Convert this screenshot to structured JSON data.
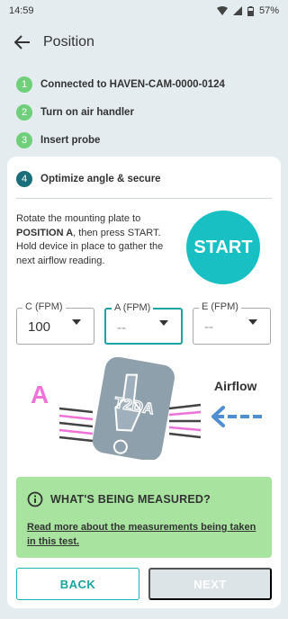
{
  "status_bar": {
    "time": "14:59",
    "battery_percent": "57%"
  },
  "app_bar": {
    "title": "Position"
  },
  "steps": [
    {
      "number": "1",
      "label": "Connected to HAVEN-CAM-0000-0124"
    },
    {
      "number": "2",
      "label": "Turn on air handler"
    },
    {
      "number": "3",
      "label": "Insert probe"
    }
  ],
  "current_step": {
    "number": "4",
    "label": "Optimize angle & secure"
  },
  "instructions": {
    "part1": "Rotate the mounting plate to ",
    "position": "POSITION A",
    "part2": ", then press START. Hold device in place to gather the next airflow reading."
  },
  "start_button": {
    "label": "START"
  },
  "fields": [
    {
      "label": "C (FPM)",
      "value": "100"
    },
    {
      "label": "A (FPM)",
      "value": "--"
    },
    {
      "label": "E (FPM)",
      "value": "--"
    }
  ],
  "illustration": {
    "position_letter": "A",
    "plate_text": "T2DA",
    "airflow_label": "Airflow"
  },
  "info_box": {
    "title": "WHAT'S BEING MEASURED?",
    "link_text": "Read more about the measurements being taken in this test."
  },
  "buttons": {
    "back": "BACK",
    "next": "NEXT"
  },
  "colors": {
    "accent": "#19c0c3",
    "step_done": "#6fcf7a",
    "info_bg": "#a8e3a0",
    "pink": "#ee72d8",
    "arrow_blue": "#4f8fd1"
  }
}
